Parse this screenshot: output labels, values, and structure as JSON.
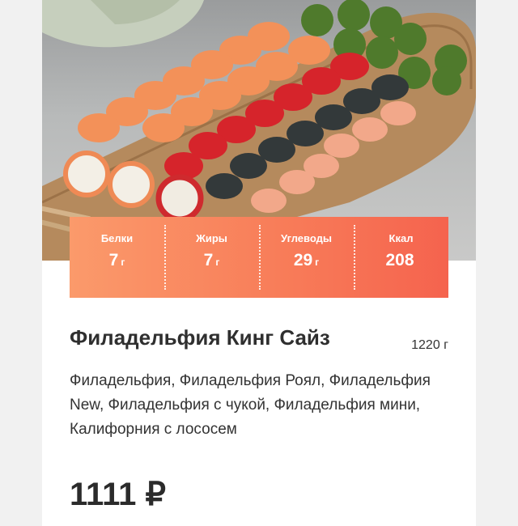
{
  "product": {
    "image_alt": "Сет роллов",
    "nutrition": [
      {
        "label": "Белки",
        "value": "7",
        "unit": "г"
      },
      {
        "label": "Жиры",
        "value": "7",
        "unit": "г"
      },
      {
        "label": "Углеводы",
        "value": "29",
        "unit": "г"
      },
      {
        "label": "Ккал",
        "value": "208",
        "unit": ""
      }
    ],
    "title": "Филадельфия Кинг Сайз",
    "weight": "1220 г",
    "description": "Филадельфия, Филадельфия Роял, Филадельфия New, Филадельфия с чукой, Филадельфия мини, Калифорния с лососем",
    "price": "1111 ₽"
  }
}
